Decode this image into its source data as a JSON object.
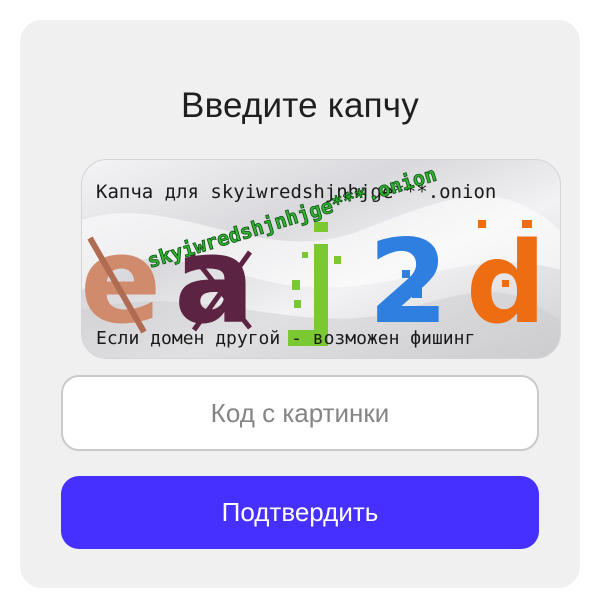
{
  "form": {
    "title": "Введите капчу",
    "input_placeholder": "Код с картинки",
    "input_value": "",
    "submit_label": "Подтвердить"
  },
  "captcha": {
    "top_text": "Капча для skyiwredshjnhjge***.onion",
    "overlay_text": "skyiwredshjnhjge***.onion",
    "bottom_text": "Если домен другой - возможен фишинг",
    "letters": [
      "e",
      "a",
      "j",
      "2",
      "d"
    ],
    "letter_colors": [
      "#d08a6c",
      "#5c2442",
      "#7ac832",
      "#2f7fe0",
      "#ee6d10"
    ],
    "overlay_color": "#2fb52f"
  },
  "colors": {
    "card_background": "#f0f0f1",
    "button_background": "#4530ff",
    "button_text": "#ffffff",
    "input_border": "#c9c9cc"
  }
}
